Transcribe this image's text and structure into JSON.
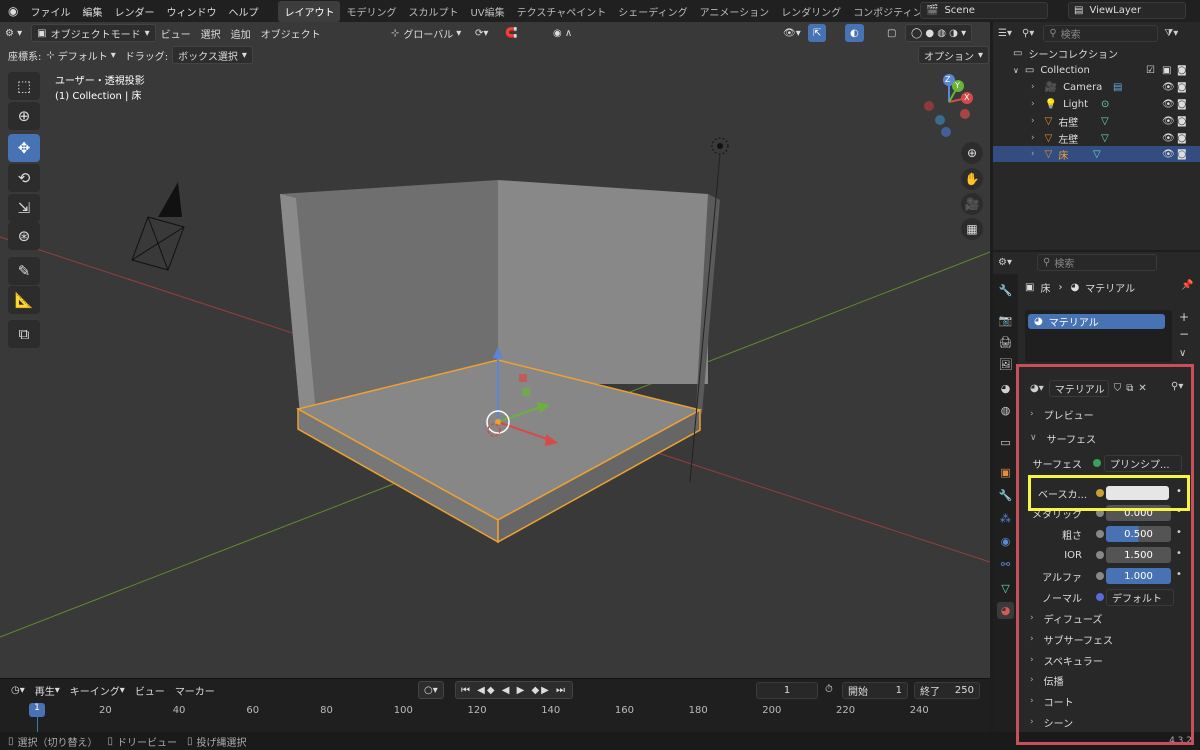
{
  "topbar": {
    "menus": [
      "ファイル",
      "編集",
      "レンダー",
      "ウィンドウ",
      "ヘルプ"
    ],
    "workspaces": [
      "レイアウト",
      "モデリング",
      "スカルプト",
      "UV編集",
      "テクスチャペイント",
      "シェーディング",
      "アニメーション",
      "レンダリング",
      "コンポジティング"
    ],
    "active_workspace": "レイアウト",
    "scene": "Scene",
    "view_layer": "ViewLayer"
  },
  "viewport": {
    "mode": "オブジェクトモード",
    "menus": [
      "ビュー",
      "選択",
      "追加",
      "オブジェクト"
    ],
    "transform": "グローバル",
    "coord_label": "座標系:",
    "coord_value": "デフォルト",
    "drag_label": "ドラッグ:",
    "drag_value": "ボックス選択",
    "options": "オプション",
    "overlay_title": "ユーザー・透視投影",
    "overlay_subtitle": "(1) Collection | 床",
    "axis_x": "X",
    "axis_y": "Y",
    "axis_z": "Z"
  },
  "timeline": {
    "menus": [
      "再生",
      "キーイング",
      "ビュー",
      "マーカー"
    ],
    "current_frame": "1",
    "start_label": "開始",
    "start": "1",
    "end_label": "終了",
    "end": "250",
    "ticks": [
      "20",
      "40",
      "60",
      "80",
      "100",
      "120",
      "140",
      "160",
      "180",
      "200",
      "220",
      "240"
    ],
    "playhead": "1"
  },
  "statusbar": {
    "items": [
      "選択（切り替え）",
      "ドリービュー",
      "投げ縄選択"
    ],
    "version": "4.3.2"
  },
  "outliner": {
    "search_placeholder": "検索",
    "root": "シーンコレクション",
    "collection": "Collection",
    "items": [
      "Camera",
      "Light",
      "右壁",
      "左壁",
      "床"
    ],
    "selected": "床"
  },
  "properties": {
    "search_placeholder": "検索",
    "breadcrumb_object": "床",
    "breadcrumb_material": "マテリアル",
    "material_slot": "マテリアル",
    "material_name": "マテリアル",
    "sections": {
      "preview": "プレビュー",
      "surface": "サーフェス"
    },
    "surface_label": "サーフェス",
    "surface_value": "プリンシプ...",
    "rows": [
      {
        "label": "ベースカ...",
        "value": ""
      },
      {
        "label": "メタリック",
        "value": "0.000"
      },
      {
        "label": "粗さ",
        "value": "0.500"
      },
      {
        "label": "IOR",
        "value": "1.500"
      },
      {
        "label": "アルファ",
        "value": "1.000"
      },
      {
        "label": "ノーマル",
        "value": "デフォルト"
      }
    ],
    "subsections": [
      "ディフューズ",
      "サブサーフェス",
      "スペキュラー",
      "伝播",
      "コート",
      "シーン"
    ]
  },
  "colors": {
    "accent": "#4772b3",
    "selection_orange": "#f0a030",
    "highlight_yellow": "#f5f542",
    "annotation_red": "#c8505a"
  }
}
